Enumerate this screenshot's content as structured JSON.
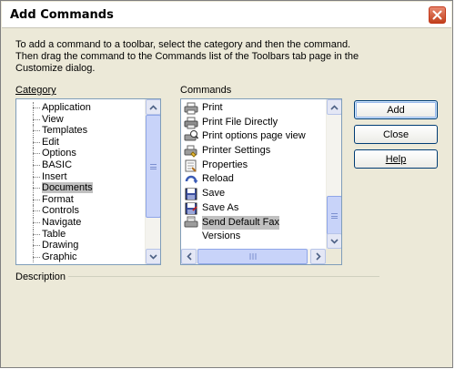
{
  "dialog": {
    "title": "Add Commands",
    "instructions": "To add a command to a toolbar, select the category and then the command. Then drag the command to the Commands list of the Toolbars tab page in the Customize dialog."
  },
  "category": {
    "label": "Category",
    "items": [
      "Application",
      "View",
      "Templates",
      "Edit",
      "Options",
      "BASIC",
      "Insert",
      "Documents",
      "Format",
      "Controls",
      "Navigate",
      "Table",
      "Drawing",
      "Graphic"
    ],
    "selected": "Documents"
  },
  "commands": {
    "label": "Commands",
    "items": [
      {
        "label": "Print",
        "icon": "printer-icon"
      },
      {
        "label": "Print File Directly",
        "icon": "printer-direct-icon"
      },
      {
        "label": "Print options page view",
        "icon": "print-options-icon"
      },
      {
        "label": "Printer Settings",
        "icon": "printer-settings-icon"
      },
      {
        "label": "Properties",
        "icon": "properties-icon"
      },
      {
        "label": "Reload",
        "icon": "reload-icon"
      },
      {
        "label": "Save",
        "icon": "save-icon"
      },
      {
        "label": "Save As",
        "icon": "save-as-icon"
      },
      {
        "label": "Send Default Fax",
        "icon": "fax-icon"
      },
      {
        "label": "Versions",
        "icon": ""
      }
    ],
    "selected": "Send Default Fax"
  },
  "buttons": {
    "add": "Add",
    "close": "Close",
    "help": "Help"
  },
  "description": {
    "label": "Description"
  },
  "colors": {
    "border": "#7f9db9",
    "selection": "#c0c0c0",
    "dialog_bg": "#ece9d8",
    "close_red": "#c1401c"
  }
}
